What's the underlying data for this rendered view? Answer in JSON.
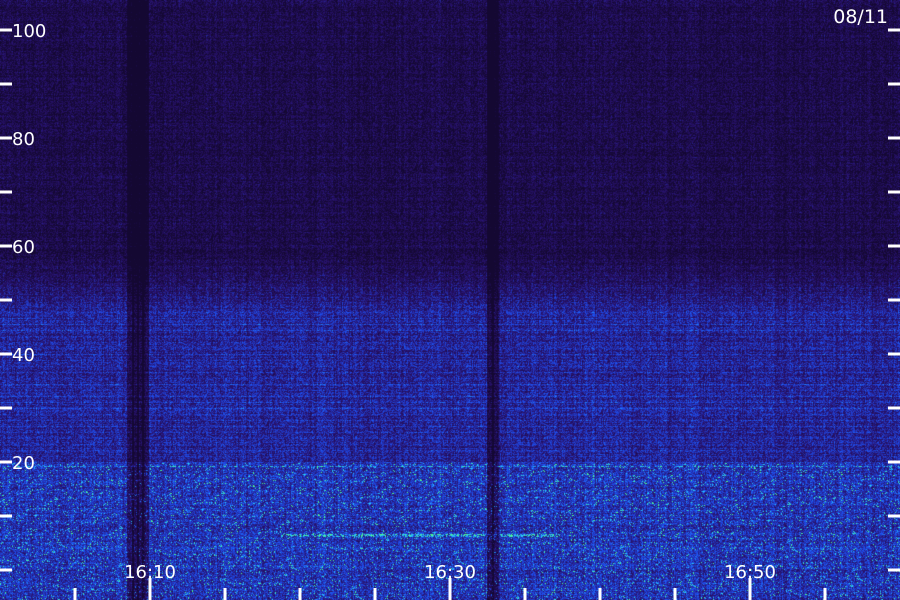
{
  "chart_data": {
    "type": "heatmap",
    "title": "",
    "date_label": "08/11",
    "y_axis": {
      "range": [
        0,
        100
      ],
      "labeled_ticks": [
        "20",
        "40",
        "60",
        "80",
        "100"
      ],
      "tick_values": [
        0,
        10,
        20,
        30,
        40,
        50,
        60,
        70,
        80,
        90,
        100
      ]
    },
    "x_axis": {
      "labeled_ticks": [
        "16:10",
        "16:30",
        "16:50"
      ],
      "minor_tick_step_minutes": 5,
      "range": [
        "16:05",
        "16:55"
      ]
    },
    "colors": {
      "background": "#1a0a40",
      "low": "#2a1270",
      "mid": "#2040e0",
      "high": "#30c8ff",
      "peak": "#40ff90",
      "axis": "#ffffff"
    }
  }
}
